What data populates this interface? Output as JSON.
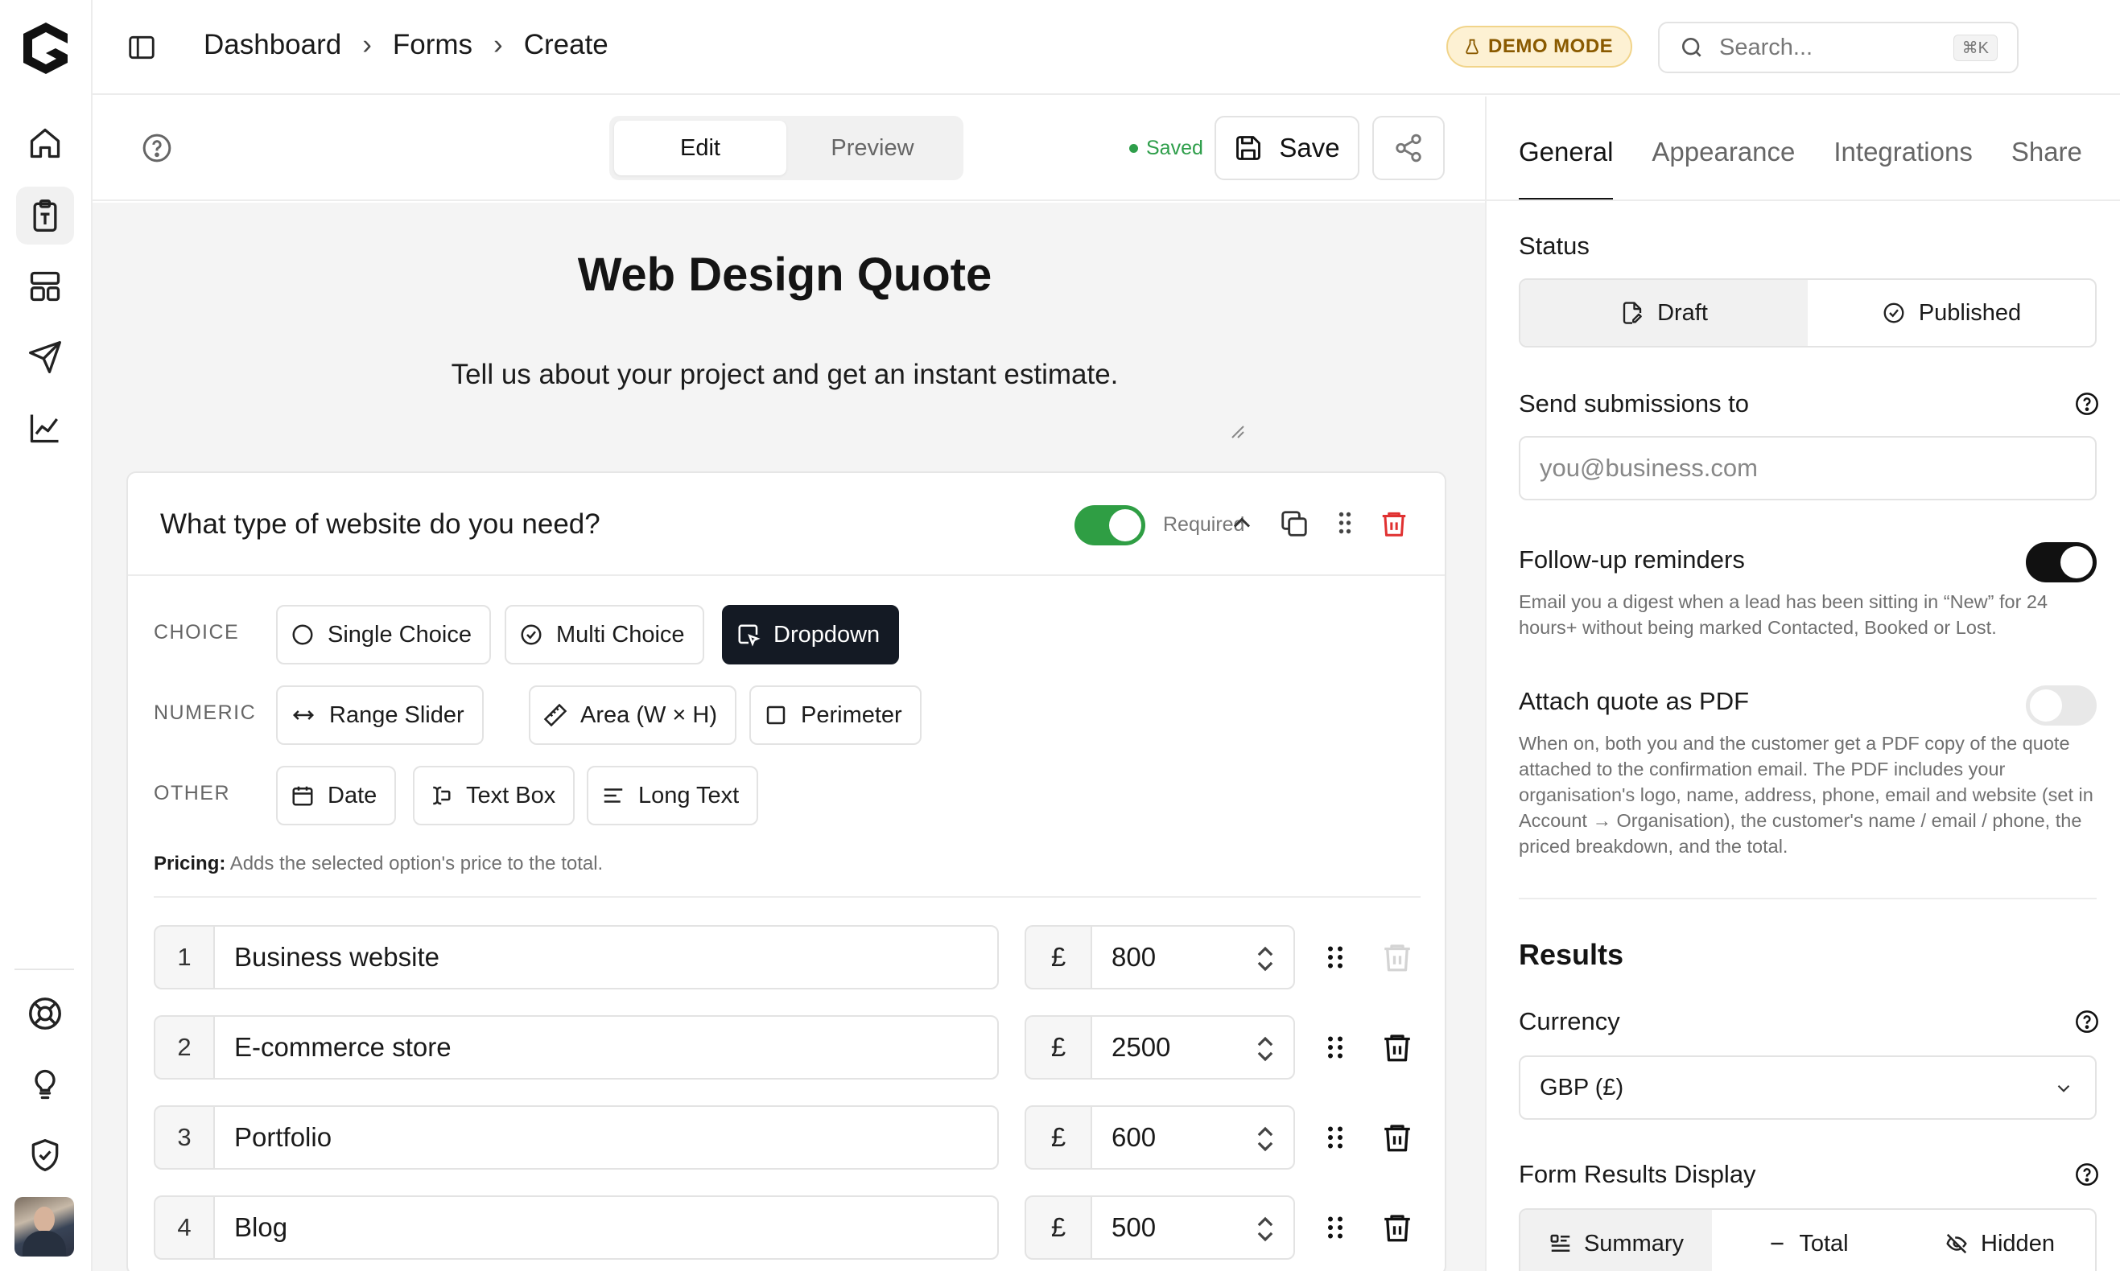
{
  "breadcrumb": [
    "Dashboard",
    "Forms",
    "Create"
  ],
  "demo_badge": "DEMO MODE",
  "search": {
    "placeholder": "Search...",
    "shortcut": "⌘K"
  },
  "editor": {
    "modes": [
      "Edit",
      "Preview"
    ],
    "active_mode": "Edit",
    "saved_status": "Saved",
    "save_label": "Save"
  },
  "form": {
    "title": "Web Design Quote",
    "description": "Tell us about your project and get an instant estimate."
  },
  "question": {
    "text": "What type of website do you need?",
    "required_label": "Required",
    "required": true,
    "groups": {
      "choice": {
        "label": "CHOICE",
        "types": [
          "Single Choice",
          "Multi Choice",
          "Dropdown"
        ]
      },
      "numeric": {
        "label": "NUMERIC",
        "types": [
          "Range Slider",
          "Area (W × H)",
          "Perimeter"
        ]
      },
      "other": {
        "label": "OTHER",
        "types": [
          "Date",
          "Text Box",
          "Long Text"
        ]
      }
    },
    "selected_type": "Dropdown",
    "pricing_label": "Pricing:",
    "pricing_text": "Adds the selected option's price to the total.",
    "options": [
      {
        "num": "1",
        "label": "Business website",
        "currency": "£",
        "price": "800"
      },
      {
        "num": "2",
        "label": "E-commerce store",
        "currency": "£",
        "price": "2500"
      },
      {
        "num": "3",
        "label": "Portfolio",
        "currency": "£",
        "price": "600"
      },
      {
        "num": "4",
        "label": "Blog",
        "currency": "£",
        "price": "500"
      }
    ]
  },
  "panel": {
    "tabs": [
      "General",
      "Appearance",
      "Integrations",
      "Share"
    ],
    "active_tab": "General",
    "status_label": "Status",
    "status_options": [
      "Draft",
      "Published"
    ],
    "status_selected": "Draft",
    "send_label": "Send submissions to",
    "send_placeholder": "you@business.com",
    "followup_label": "Follow-up reminders",
    "followup_on": true,
    "followup_desc": "Email you a digest when a lead has been sitting in “New” for 24 hours+ without being marked Contacted, Booked or Lost.",
    "pdf_label": "Attach quote as PDF",
    "pdf_on": false,
    "pdf_desc": "When on, both you and the customer get a PDF copy of the quote attached to the confirmation email. The PDF includes your organisation's logo, name, address, phone, email and website (set in Account → Organisation), the customer's name / email / phone, the priced breakdown, and the total.",
    "results_title": "Results",
    "currency_label": "Currency",
    "currency_value": "GBP (£)",
    "display_label": "Form Results Display",
    "display_options": [
      "Summary",
      "Total",
      "Hidden"
    ],
    "display_selected": "Summary"
  },
  "colors": {
    "toggle_green": "#2f9e44",
    "selected_chip": "#141a24",
    "delete_red": "#e03131",
    "saved_green": "#2e9e4a",
    "demo_bg": "#fdf1d3"
  }
}
